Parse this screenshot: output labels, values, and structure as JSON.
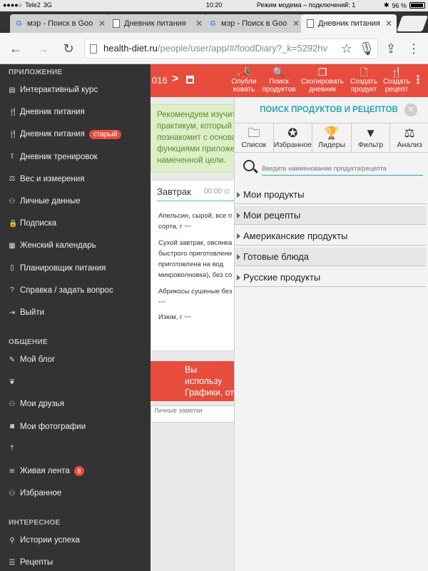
{
  "status_bar": {
    "carrier": "Tele2",
    "network": "3G",
    "time": "10:20",
    "hotspot": "Режим модема – подключений: 1",
    "battery": "96 %"
  },
  "tabs": [
    {
      "title": "мэр - Поиск в Goo",
      "icon": "google-icon",
      "active": false
    },
    {
      "title": "Дневник питания",
      "icon": "page-icon",
      "active": false
    },
    {
      "title": "мэр - Поиск в Goo",
      "icon": "google-icon",
      "active": false
    },
    {
      "title": "Дневник питания",
      "icon": "page-icon",
      "active": true
    }
  ],
  "address_bar": {
    "host": "health-diet.ru",
    "path": "/people/user/app/#/foodDiary?_k=5292hv"
  },
  "sidebar": {
    "sections": [
      {
        "title": "ПРИЛОЖЕНИЕ",
        "items": [
          {
            "label": "Интерактивный курс",
            "icon": "book-icon"
          },
          {
            "label": "Дневник питания",
            "icon": "fork-knife-icon"
          },
          {
            "label": "Дневник питания",
            "icon": "fork-knife-icon",
            "badge": "старый"
          },
          {
            "label": "Дневник тренировок",
            "icon": "dumbbell-icon"
          },
          {
            "label": "Вес и измерения",
            "icon": "scale-icon"
          },
          {
            "label": "Личные данные",
            "icon": "people-icon"
          },
          {
            "label": "Подписка",
            "icon": "lock-icon"
          },
          {
            "label": "Женский календарь",
            "icon": "calendar-icon"
          },
          {
            "label": "Планировщик питания",
            "icon": "clipboard-icon"
          },
          {
            "label": "Справка / задать вопрос",
            "icon": "question-icon"
          },
          {
            "label": "Выйти",
            "icon": "sign-out-icon"
          }
        ]
      },
      {
        "title": "ОБЩЕНИЕ",
        "items": [
          {
            "label": "Мой блог",
            "icon": "blog-icon"
          },
          {
            "label": "",
            "icon": "handshake-icon"
          },
          {
            "label": "Мои друзья",
            "icon": "friends-icon"
          },
          {
            "label": "Мои фотографии",
            "icon": "camera-icon"
          },
          {
            "label": "",
            "icon": "upload-icon"
          },
          {
            "label": "Живая лента",
            "icon": "rss-icon",
            "count": "8"
          },
          {
            "label": "Избранное",
            "icon": "favorites-icon"
          }
        ]
      },
      {
        "title": "ИНТЕРЕСНОЕ",
        "items": [
          {
            "label": "Истории успеха",
            "icon": "run-icon"
          },
          {
            "label": "Рецепты",
            "icon": "recipe-icon"
          }
        ]
      }
    ]
  },
  "header": {
    "date_fragment": "016",
    "actions": [
      {
        "label": "Опубли\nковать",
        "icon": "megaphone-icon"
      },
      {
        "label": "Поиск\nпродуктов",
        "icon": "search-icon"
      },
      {
        "label": "Скопировать\nдневник",
        "icon": "copy-icon"
      },
      {
        "label": "Создать\nпродукт",
        "icon": "document-icon"
      },
      {
        "label": "Создать\nрецепт",
        "icon": "fork-knife-icon"
      }
    ]
  },
  "diary": {
    "tip": "Рекомендуем изучит практикум, который познакомит с основа функциями приложе намеченной цели.",
    "meal": {
      "title": "Завтрак",
      "time": "00:00"
    },
    "foods": [
      "Апельсин, сырой, все п сорта, г",
      "Сухой завтрак, овсянка быстрого приготовлени приготовлена на вод микроволновка), без со",
      "Абрикосы сушеные без",
      "Изюм, г"
    ],
    "notice": "Вы использу Графики, от версии.",
    "notes_placeholder": "Личные заметки"
  },
  "panel": {
    "title": "ПОИСК ПРОДУКТОВ И РЕЦЕПТОВ",
    "tabs": [
      {
        "label": "Список",
        "icon": "folder-icon"
      },
      {
        "label": "Избранное",
        "icon": "star-icon"
      },
      {
        "label": "Лидеры",
        "icon": "trophy-icon"
      },
      {
        "label": "Фильтр",
        "icon": "filter-icon"
      },
      {
        "label": "Анализ",
        "icon": "balance-icon"
      }
    ],
    "search_placeholder": "Введите наименование продукта/рецепта",
    "categories": [
      "Мои продукты",
      "Мои рецепты",
      "Американские продукты",
      "Готовые блюда",
      "Русские продукты"
    ]
  }
}
